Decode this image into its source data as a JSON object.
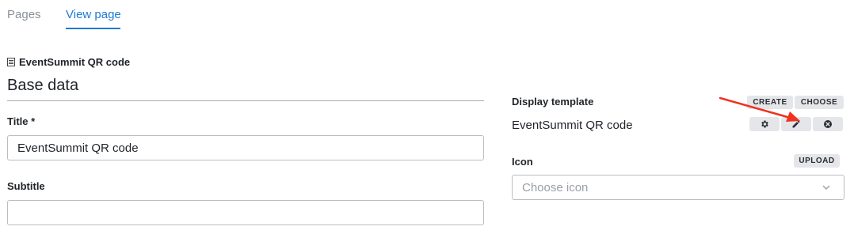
{
  "tabs": {
    "pages": "Pages",
    "view_page": "View page"
  },
  "page_name": "EventSummit QR code",
  "section_title": "Base data",
  "form": {
    "title_label": "Title *",
    "title_value": "EventSummit QR code",
    "subtitle_label": "Subtitle",
    "subtitle_value": ""
  },
  "display_template": {
    "label": "Display template",
    "value": "EventSummit QR code",
    "create_label": "CREATE",
    "choose_label": "CHOOSE",
    "actions": [
      "gear-icon",
      "pencil-icon",
      "close-circle-icon"
    ]
  },
  "icon_field": {
    "label": "Icon",
    "upload_label": "UPLOAD",
    "placeholder": "Choose icon"
  },
  "colors": {
    "accent": "#1f7ad1",
    "annotation_arrow": "#f0321e"
  }
}
